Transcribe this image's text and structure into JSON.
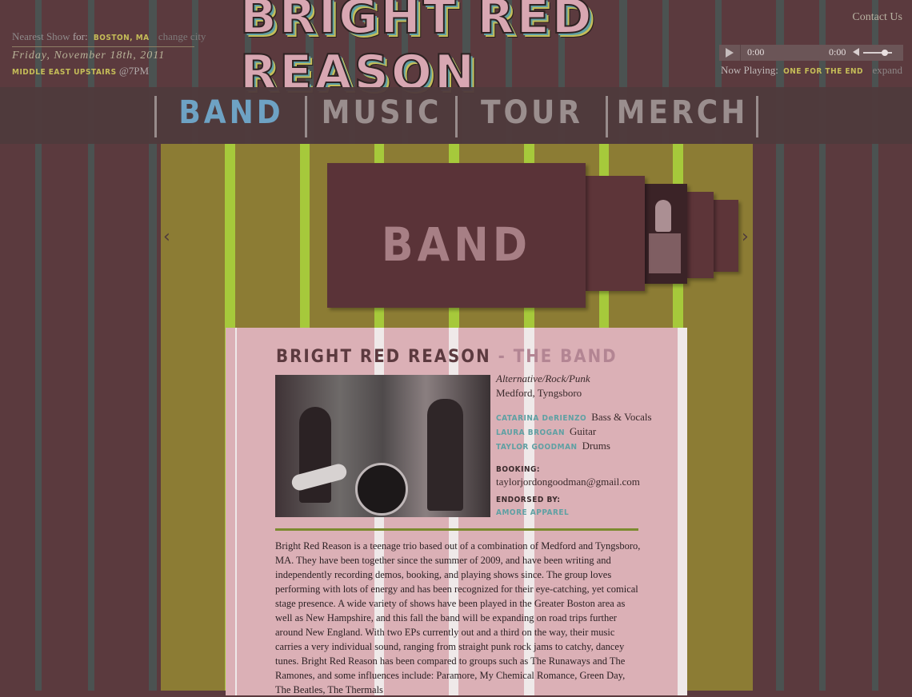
{
  "header": {
    "nearest_label": "Nearest Show",
    "for_label": "for:",
    "city": "BOSTON, MA",
    "change_city": "change city",
    "date": "Friday, November 18th, 2011",
    "venue": "MIDDLE EAST UPSTAIRS",
    "time": "@7PM",
    "logo_text": "BRIGHT REASON",
    "logo_text_full": "BRIGHT RED REASON",
    "contact": "Contact Us",
    "player": {
      "time_elapsed": "0:00",
      "time_total": "0:00",
      "volume": 0.6
    },
    "now_playing_label": "Now Playing:",
    "now_playing_song": "ONE FOR THE END",
    "expand": "expand"
  },
  "nav": {
    "items": [
      {
        "label": "BAND",
        "active": true
      },
      {
        "label": "MUSIC",
        "active": false
      },
      {
        "label": "TOUR",
        "active": false
      },
      {
        "label": "MERCH",
        "active": false
      }
    ]
  },
  "slider": {
    "prev_arrow": "‹",
    "next_arrow": "›",
    "main_label": "BAND"
  },
  "band": {
    "title": "BRIGHT RED REASON",
    "title_sub": "- THE BAND",
    "genre": "Alternative/Rock/Punk",
    "location": "Medford, Tyngsboro",
    "members": [
      {
        "name": "CATARINA DeRIENZO",
        "role": "Bass & Vocals"
      },
      {
        "name": "LAURA BROGAN",
        "role": "Guitar"
      },
      {
        "name": "TAYLOR GOODMAN",
        "role": "Drums"
      }
    ],
    "booking_label": "BOOKING:",
    "booking_email": "taylorjordongoodman@gmail.com",
    "endorsed_label": "ENDORSED BY:",
    "endorser": "AMORE APPAREL",
    "bio": "Bright Red Reason is a teenage trio based out of a combination of Medford and Tyngsboro, MA. They have been together since the summer of 2009, and have been writing and independently recording demos, booking, and playing shows since. The group loves performing with lots of energy and has been recognized for their eye-catching, yet comical stage presence. A wide variety of shows have been played in the Greater Boston area as well as New Hampshire, and this fall the band will be expanding on road trips further around New England. With two EPs currently out and a third on the way, their music carries a very individual sound, ranging from straight punk rock jams to catchy, dancey tunes. Bright Red Reason has been compared to groups such as The Runaways and The Ramones, and some influences include: Paramore, My Chemical Romance, Green Day, The Beatles, The Thermals"
  }
}
